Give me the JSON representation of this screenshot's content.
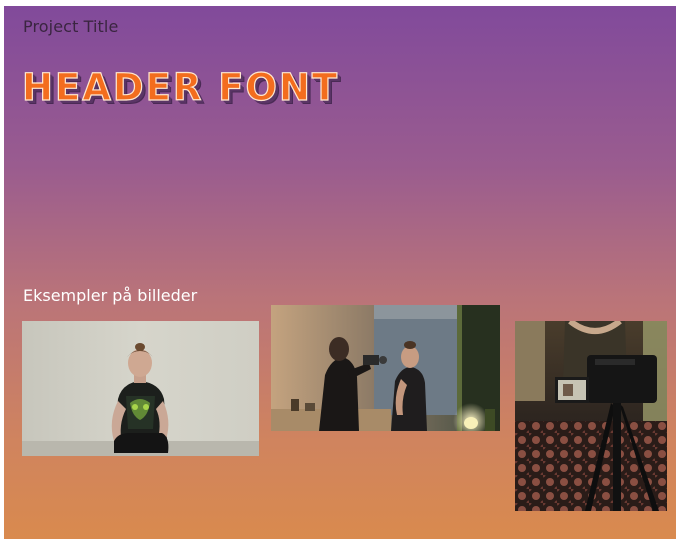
{
  "page": {
    "project_title": "Project Title",
    "header_text": "HEADER FONT",
    "section_label": "Eksempler på billeder"
  },
  "colors": {
    "gradient_top": "#814a9b",
    "gradient_bottom": "#d98a4e",
    "header_fill": "#f36d1e",
    "header_outline": "#ffe7cf"
  },
  "gallery": [
    {
      "name": "photo-person-seated-against-wall"
    },
    {
      "name": "photo-filming-scene-with-camera"
    },
    {
      "name": "photo-camera-on-tripod"
    }
  ]
}
